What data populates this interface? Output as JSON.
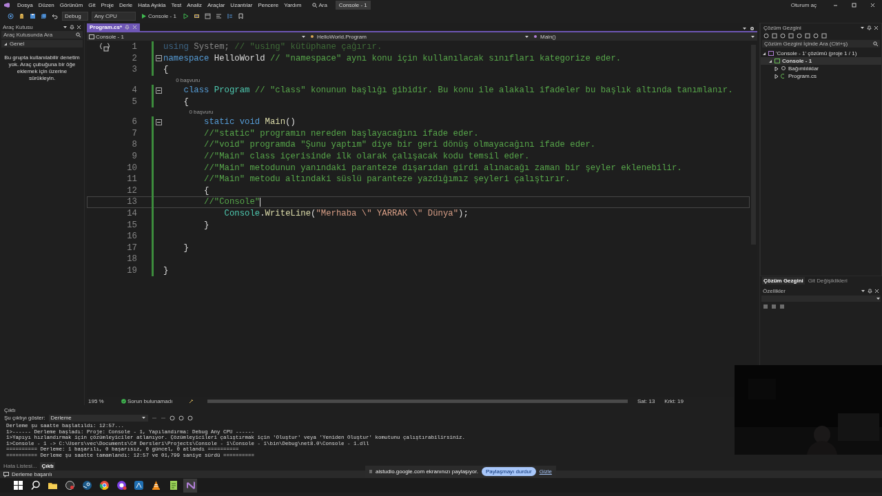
{
  "window": {
    "title": "Console - 1",
    "sign_in": "Oturum aç"
  },
  "menu": [
    {
      "label": "Dosya"
    },
    {
      "label": "Düzen"
    },
    {
      "label": "Görünüm"
    },
    {
      "label": "Git"
    },
    {
      "label": "Proje"
    },
    {
      "label": "Derle"
    },
    {
      "label": "Hata Ayıkla"
    },
    {
      "label": "Test"
    },
    {
      "label": "Analiz"
    },
    {
      "label": "Araçlar"
    },
    {
      "label": "Uzantılar"
    },
    {
      "label": "Pencere"
    },
    {
      "label": "Yardım"
    }
  ],
  "search": {
    "label": "Ara"
  },
  "toolbar": {
    "configuration": "Debug",
    "platform": "Any CPU",
    "run_target": "Console - 1"
  },
  "toolbox": {
    "title": "Araç Kutusu",
    "search_placeholder": "Araç Kutusunda Ara",
    "group": {
      "label": "Genel",
      "expanded": true
    },
    "empty_message": "Bu grupta kullanılabilir denetim yok. Araç çubuğuna bir öğe eklemek için üzerine sürükleyin."
  },
  "editor": {
    "tabs": [
      {
        "label": "Program.cs*",
        "selected": true
      }
    ],
    "nav": {
      "project": "Console - 1",
      "type": "HelloWorld.Program",
      "member": "Main()"
    },
    "lines": [
      {
        "number": "1",
        "tokens": [
          {
            "kind": "kw-faded",
            "text": "using"
          },
          {
            "kind": "plain-faded",
            "text": " System;"
          },
          {
            "kind": "comment-faded",
            "text": " // \"using\" kütüphane çağırır."
          }
        ]
      },
      {
        "number": "2",
        "collapsible": true,
        "tokens": [
          {
            "kind": "kw",
            "text": "namespace"
          },
          {
            "kind": "plain",
            "text": " HelloWorld "
          },
          {
            "kind": "comment",
            "text": "// \"namespace\" aynı konu için kullanılacak sınıfları kategorize eder."
          }
        ]
      },
      {
        "number": "3",
        "tokens": [
          {
            "kind": "plain",
            "text": "{"
          }
        ]
      },
      {
        "number": "4",
        "collapsible": true,
        "codelens": "0 başvuru",
        "tokens": [
          {
            "kind": "kw",
            "text": "    class"
          },
          {
            "kind": "type",
            "text": " Program"
          },
          {
            "kind": "comment",
            "text": " // \"class\" konunun başlığı gibidir. Bu konu ile alakalı ifadeler bu başlık altında tanımlanır."
          }
        ]
      },
      {
        "number": "5",
        "tokens": [
          {
            "kind": "plain",
            "text": "    {"
          }
        ]
      },
      {
        "number": "6",
        "collapsible": true,
        "codelens": "0 başvuru",
        "tokens": [
          {
            "kind": "kw",
            "text": "        static void"
          },
          {
            "kind": "method",
            "text": " Main"
          },
          {
            "kind": "plain",
            "text": "()"
          }
        ]
      },
      {
        "number": "7",
        "tokens": [
          {
            "kind": "comment",
            "text": "        //\"static\" programın nereden başlayacağını ifade eder."
          }
        ]
      },
      {
        "number": "8",
        "tokens": [
          {
            "kind": "comment",
            "text": "        //\"void\" programda \"Şunu yaptım\" diye bir geri dönüş olmayacağını ifade eder."
          }
        ]
      },
      {
        "number": "9",
        "tokens": [
          {
            "kind": "comment",
            "text": "        //\"Main\" class içerisinde ilk olarak çalışacak kodu temsil eder."
          }
        ]
      },
      {
        "number": "10",
        "tokens": [
          {
            "kind": "comment",
            "text": "        //\"Main\" metodunun yanındaki paranteze dışarıdan girdi alınacağı zaman bir şeyler eklenebilir."
          }
        ]
      },
      {
        "number": "11",
        "tokens": [
          {
            "kind": "comment",
            "text": "        //\"Main\" metodu altındaki süslü paranteze yazdığımız şeyleri çalıştırır."
          }
        ]
      },
      {
        "number": "12",
        "tokens": [
          {
            "kind": "plain",
            "text": "        {"
          }
        ]
      },
      {
        "number": "13",
        "current": true,
        "tokens": [
          {
            "kind": "comment",
            "text": "        //\"Console\""
          }
        ]
      },
      {
        "number": "14",
        "tokens": [
          {
            "kind": "type",
            "text": "            Console"
          },
          {
            "kind": "plain",
            "text": "."
          },
          {
            "kind": "method",
            "text": "WriteLine"
          },
          {
            "kind": "plain",
            "text": "("
          },
          {
            "kind": "string",
            "text": "\"Merhaba \\\" YARRAK \\\" Dünya\""
          },
          {
            "kind": "plain",
            "text": ");"
          }
        ]
      },
      {
        "number": "15",
        "tokens": [
          {
            "kind": "plain",
            "text": "        }"
          }
        ]
      },
      {
        "number": "16"
      },
      {
        "number": "17",
        "tokens": [
          {
            "kind": "plain",
            "text": "    }"
          }
        ]
      },
      {
        "number": "18"
      },
      {
        "number": "19",
        "tokens": [
          {
            "kind": "plain",
            "text": "}"
          }
        ]
      }
    ],
    "status": {
      "zoom": "195 %",
      "issues": "Sorun bulunamadı",
      "line": "Sat: 13",
      "column": "Krkt: 19"
    }
  },
  "solution_explorer": {
    "title": "Çözüm Gezgini",
    "search_placeholder": "Çözüm Gezgini İçinde Ara (Ctrl+ş)",
    "tree": [
      {
        "label": "'Console - 1' çözümü (proje 1 / 1)",
        "kind": "solution",
        "expanded": true,
        "selected": false,
        "children": [
          {
            "label": "Console - 1",
            "kind": "project",
            "expanded": true,
            "selected": true,
            "children": [
              {
                "label": "Bağımlılıklar",
                "kind": "dependencies",
                "expanded": false,
                "selected": false
              },
              {
                "label": "Program.cs",
                "kind": "csharp",
                "expanded": false,
                "selected": false
              }
            ]
          }
        ]
      }
    ],
    "tabs": [
      {
        "label": "Çözüm Gezgini",
        "selected": true
      },
      {
        "label": "Git Değişiklikleri",
        "selected": false
      }
    ]
  },
  "properties": {
    "title": "Özellikler"
  },
  "output": {
    "title": "Çıktı",
    "source_label": "Şu çıktıyı göster:",
    "source": "Derleme",
    "lines": [
      "Derleme şu saatte başlatıldı: 12:57...",
      "1>------ Derleme başladı: Proje: Console - 1, Yapılandırma: Debug Any CPU ------",
      "1>Yapıyı hızlandırmak için çözümleyiciler atlanıyor. Çözümleyicileri çalıştırmak için 'Oluştur' veya 'Yeniden Oluştur' komutunu çalıştırabilirsiniz.",
      "1>Console - 1 -> C:\\Users\\vec\\Documents\\C# Dersleri\\Projects\\Console - 1\\Console - 1\\bin\\Debug\\net8.0\\Console - 1.dll",
      "========== Derleme: 1 başarılı, 0 başarısız, 0 güncel, 0 atlandı ==========",
      "========== Derleme şu saatte tamamlandı: 12:57 ve 01,799 saniye sürdü =========="
    ],
    "tabs": [
      {
        "label": "Hata Listesi...",
        "selected": false
      },
      {
        "label": "Çıktı",
        "selected": true
      }
    ]
  },
  "status_bar": "Derleme başarılı",
  "share_bar": {
    "message": "aistudio.google.com ekranınızı paylaşıyor.",
    "stop": "Paylaşmayı durdur",
    "hide": "Gizle"
  },
  "taskbar": [
    {
      "kind": "start",
      "selected": false
    },
    {
      "kind": "search",
      "selected": false
    },
    {
      "kind": "folder",
      "selected": false
    },
    {
      "kind": "disc",
      "selected": false
    },
    {
      "kind": "steam",
      "selected": false
    },
    {
      "kind": "browser",
      "selected": false
    },
    {
      "kind": "chat",
      "selected": false
    },
    {
      "kind": "app",
      "selected": false
    },
    {
      "kind": "cone",
      "selected": false
    },
    {
      "kind": "notepad",
      "selected": false
    },
    {
      "kind": "ide",
      "selected": true
    }
  ]
}
